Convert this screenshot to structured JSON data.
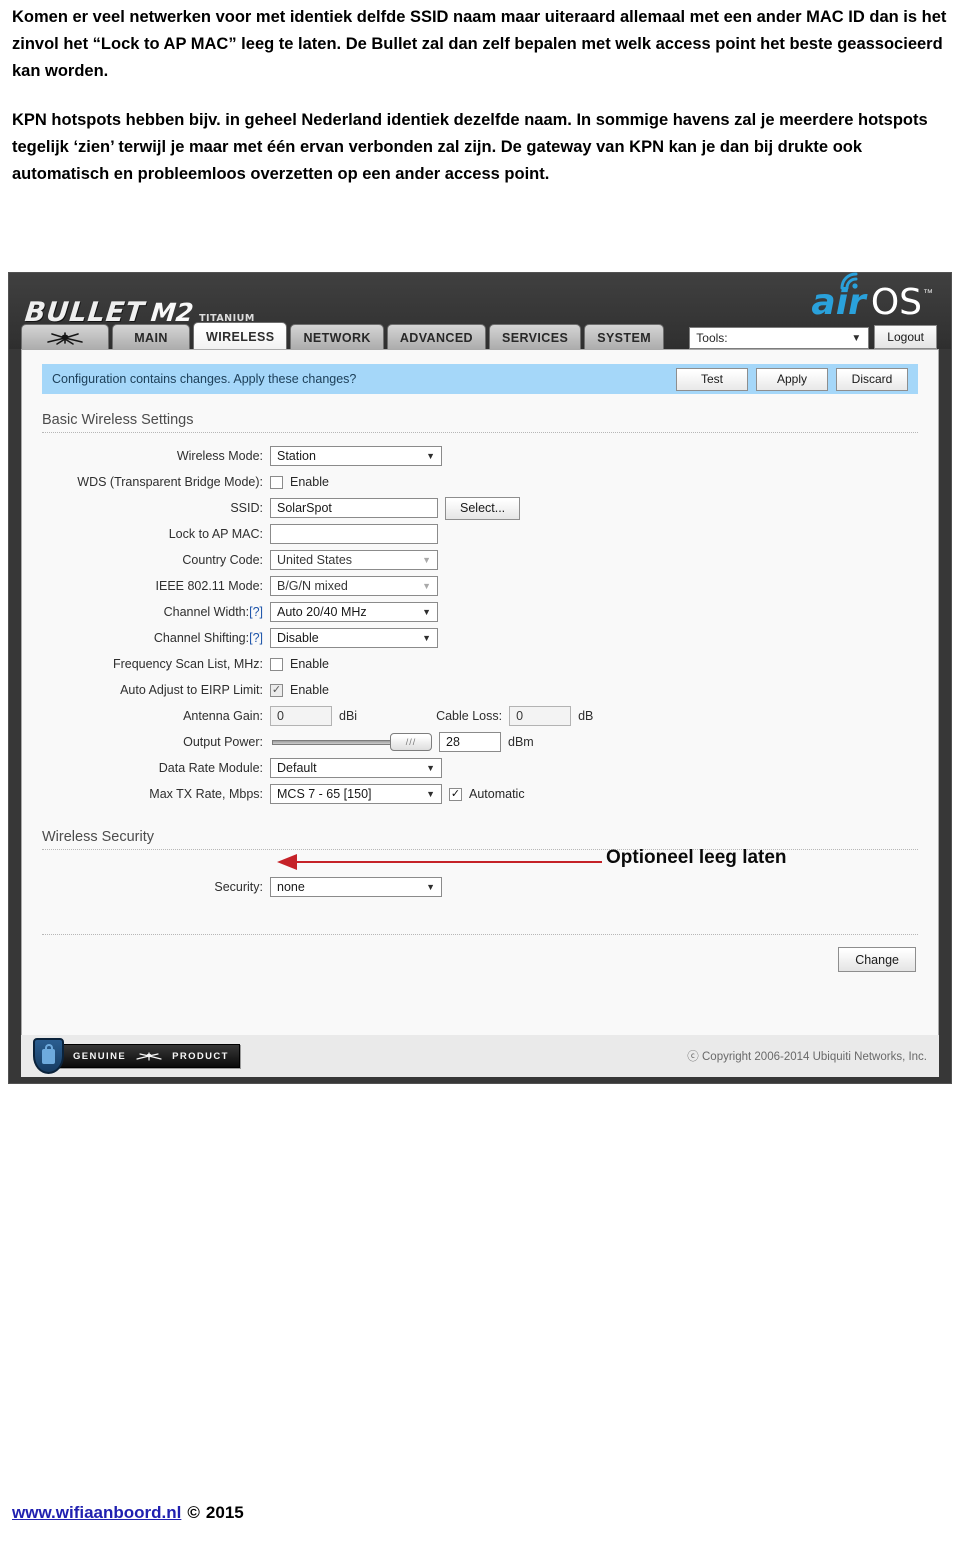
{
  "document": {
    "paragraphs": [
      "Komen er veel netwerken voor met identiek delfde SSID naam maar uiteraard allemaal met een ander MAC ID dan is het zinvol het “Lock to AP MAC” leeg te laten. De Bullet zal dan zelf bepalen met welk access point het beste geassocieerd kan worden.",
      "KPN hotspots hebben bijv. in geheel Nederland identiek dezelfde naam. In sommige havens zal je meerdere hotspots tegelijk ‘zien’ terwijl je maar met één ervan verbonden zal zijn. De gateway van KPN kan je dan bij drukte ook automatisch en probleemloos overzetten op een ander access point."
    ]
  },
  "annotation": {
    "text": "Optioneel leeg laten",
    "color": "#c1272d"
  },
  "page_footer": {
    "site": "www.wifiaanboord.nl",
    "copyright_symbol": "©",
    "year": "2015"
  },
  "router_ui": {
    "brand": {
      "product": "BULLET",
      "model": "M2",
      "edition": "TITANIUM",
      "os_air": "air",
      "os_os": "OS",
      "os_tm": "™",
      "air_color": "#2f9fd6"
    },
    "tabs": [
      {
        "label": "",
        "name": "ubiquiti-logo",
        "active": false
      },
      {
        "label": "MAIN",
        "name": "main",
        "active": false
      },
      {
        "label": "WIRELESS",
        "name": "wireless",
        "active": true
      },
      {
        "label": "NETWORK",
        "name": "network",
        "active": false
      },
      {
        "label": "ADVANCED",
        "name": "advanced",
        "active": false
      },
      {
        "label": "SERVICES",
        "name": "services",
        "active": false
      },
      {
        "label": "SYSTEM",
        "name": "system",
        "active": false
      }
    ],
    "tools": {
      "label": "Tools:",
      "logout": "Logout"
    },
    "notice": {
      "message": "Configuration contains changes. Apply these changes?",
      "buttons": [
        "Test",
        "Apply",
        "Discard"
      ]
    },
    "sections": {
      "basic_title": "Basic Wireless Settings",
      "security_title": "Wireless Security"
    },
    "fields": {
      "wireless_mode": {
        "label": "Wireless Mode:",
        "value": "Station"
      },
      "wds": {
        "label": "WDS (Transparent Bridge Mode):",
        "checkbox_label": "Enable",
        "checked": false
      },
      "ssid": {
        "label": "SSID:",
        "value": "SolarSpot",
        "button": "Select..."
      },
      "lock_ap_mac": {
        "label": "Lock to AP MAC:",
        "value": ""
      },
      "country_code": {
        "label": "Country Code:",
        "value": "United States"
      },
      "ieee_mode": {
        "label": "IEEE 802.11 Mode:",
        "value": "B/G/N mixed"
      },
      "channel_width": {
        "label": "Channel Width:",
        "help": "[?]",
        "value": "Auto 20/40 MHz"
      },
      "channel_shifting": {
        "label": "Channel Shifting:",
        "help": "[?]",
        "value": "Disable"
      },
      "freq_scan_list": {
        "label": "Frequency Scan List, MHz:",
        "checkbox_label": "Enable",
        "checked": false
      },
      "eirp_limit": {
        "label": "Auto Adjust to EIRP Limit:",
        "checkbox_label": "Enable",
        "checked": true
      },
      "antenna_gain": {
        "label": "Antenna Gain:",
        "value": "0",
        "unit": "dBi"
      },
      "cable_loss": {
        "label": "Cable Loss:",
        "value": "0",
        "unit": "dB"
      },
      "output_power": {
        "label": "Output Power:",
        "value": "28",
        "unit": "dBm",
        "slider_percent": 100
      },
      "data_rate_module": {
        "label": "Data Rate Module:",
        "value": "Default"
      },
      "max_tx_rate": {
        "label": "Max TX Rate, Mbps:",
        "value": "MCS 7 - 65 [150]",
        "checkbox_label": "Automatic",
        "checked": true
      },
      "security": {
        "label": "Security:",
        "value": "none"
      }
    },
    "change_button": "Change",
    "footer": {
      "genuine_left": "GENUINE",
      "genuine_right": "PRODUCT",
      "copyright": "ⓒ Copyright 2006-2014 Ubiquiti Networks, Inc."
    }
  }
}
